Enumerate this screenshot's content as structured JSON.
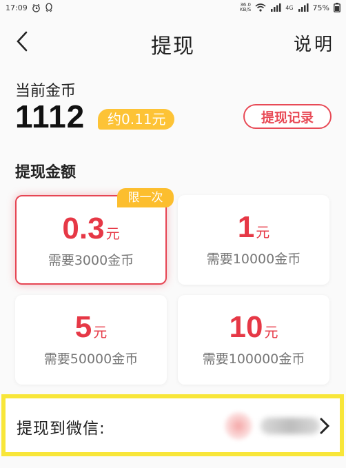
{
  "status_bar": {
    "time": "17:09",
    "speed_top": "36.0",
    "speed_bottom": "KB/S",
    "network": "4G",
    "battery": "75%"
  },
  "nav": {
    "title": "提现",
    "help": "说明"
  },
  "coins": {
    "label": "当前金币",
    "balance": "1112",
    "approx": "约0.11元",
    "record_button": "提现记录"
  },
  "amount_section": {
    "title": "提现金额",
    "unit": "元",
    "options": [
      {
        "amount": "0.3",
        "requirement": "需要3000金币",
        "badge": "限一次",
        "selected": true
      },
      {
        "amount": "1",
        "requirement": "需要10000金币",
        "selected": false
      },
      {
        "amount": "5",
        "requirement": "需要50000金币",
        "selected": false
      },
      {
        "amount": "10",
        "requirement": "需要100000金币",
        "selected": false
      }
    ]
  },
  "wechat": {
    "label": "提现到微信:"
  },
  "colors": {
    "accent_red": "#e63846",
    "badge_yellow": "#fcbe2e",
    "highlight_yellow": "#f8e639"
  }
}
